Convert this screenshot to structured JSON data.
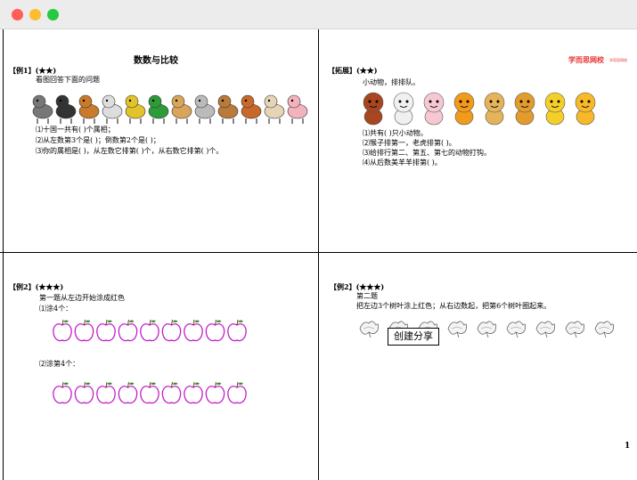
{
  "colors": {
    "apple_outline": "#c21fc9",
    "brand": "#e8322f"
  },
  "q1": {
    "page_title": "数数与比较",
    "example_label": "【例1】(★★)",
    "instruction": "看图回答下面的问题",
    "lines": [
      "⑴十国一共有(      )个属相；",
      "⑵从左数第3个是(      )；倒数第2个是(      )；",
      "⑶你的属相是(      )，从左数它排第(      )个，从右数它排第(      )个。"
    ],
    "animals": [
      "rat",
      "ox",
      "tiger",
      "rabbit",
      "dragon",
      "snake",
      "horse",
      "goat",
      "monkey",
      "rooster",
      "dog",
      "pig"
    ]
  },
  "q2": {
    "brand": "学而思网校",
    "brand_sub": "学而思网校",
    "example_label": "【拓展】(★★)",
    "instruction": "小动物，排排队。",
    "lines": [
      "⑴共有(      )只小动物。",
      "⑵猴子排第一，老虎排第(     )。",
      "⑶给排行第二、第五、第七的动物打钩。",
      "⑷从后数美羊羊排第(      )。"
    ],
    "animals": [
      "monkey",
      "sheep-white",
      "sheep-pink",
      "tiger",
      "cat",
      "lion",
      "bear-yellow",
      "winnie"
    ]
  },
  "q3": {
    "example_label": "【例2】(★★★)",
    "instruction": "第一题从左边开始涂成红色",
    "part1": "⑴涂4个：",
    "part2": "⑵涂第4个：",
    "apples_row1": 9,
    "apples_row2": 9
  },
  "q4": {
    "example_label": "【例2】(★★★)",
    "subtitle": "第二题",
    "instruction": "把左边3个树叶涂上红色；从右边数起，把第6个树叶圈起来。",
    "leaves": 9,
    "share_button": "创建分享"
  },
  "page_number": "1"
}
